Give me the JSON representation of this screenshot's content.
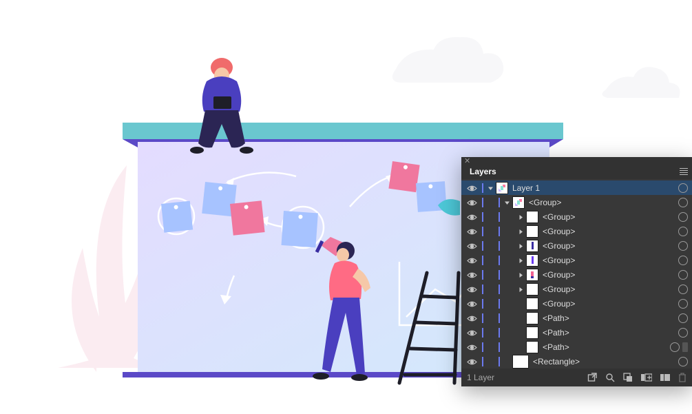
{
  "panel": {
    "title": "Layers",
    "footer_text": "1 Layer"
  },
  "tree": [
    {
      "depth": 0,
      "selected": true,
      "caret": "down",
      "thumb": "art",
      "label": "Layer 1"
    },
    {
      "depth": 1,
      "selected": false,
      "caret": "down",
      "thumb": "art",
      "label": "<Group>"
    },
    {
      "depth": 2,
      "selected": false,
      "caret": "right",
      "thumb": "blank",
      "label": "<Group>"
    },
    {
      "depth": 2,
      "selected": false,
      "caret": "right",
      "thumb": "blank",
      "label": "<Group>"
    },
    {
      "depth": 2,
      "selected": false,
      "caret": "right",
      "thumb": "person1",
      "label": "<Group>"
    },
    {
      "depth": 2,
      "selected": false,
      "caret": "right",
      "thumb": "person2",
      "label": "<Group>"
    },
    {
      "depth": 2,
      "selected": false,
      "caret": "right",
      "thumb": "person3",
      "label": "<Group>"
    },
    {
      "depth": 2,
      "selected": false,
      "caret": "right",
      "thumb": "blank",
      "label": "<Group>"
    },
    {
      "depth": 2,
      "selected": false,
      "caret": "none",
      "thumb": "blank",
      "label": "<Group>"
    },
    {
      "depth": 2,
      "selected": false,
      "caret": "none",
      "thumb": "blank",
      "label": "<Path>"
    },
    {
      "depth": 2,
      "selected": false,
      "caret": "none",
      "thumb": "blank",
      "label": "<Path>"
    },
    {
      "depth": 2,
      "selected": false,
      "caret": "none",
      "thumb": "blank",
      "label": "<Path>",
      "dim": true
    },
    {
      "depth": 1,
      "selected": false,
      "caret": "none",
      "thumb": "blank",
      "label": "<Rectangle>",
      "big": true
    }
  ]
}
